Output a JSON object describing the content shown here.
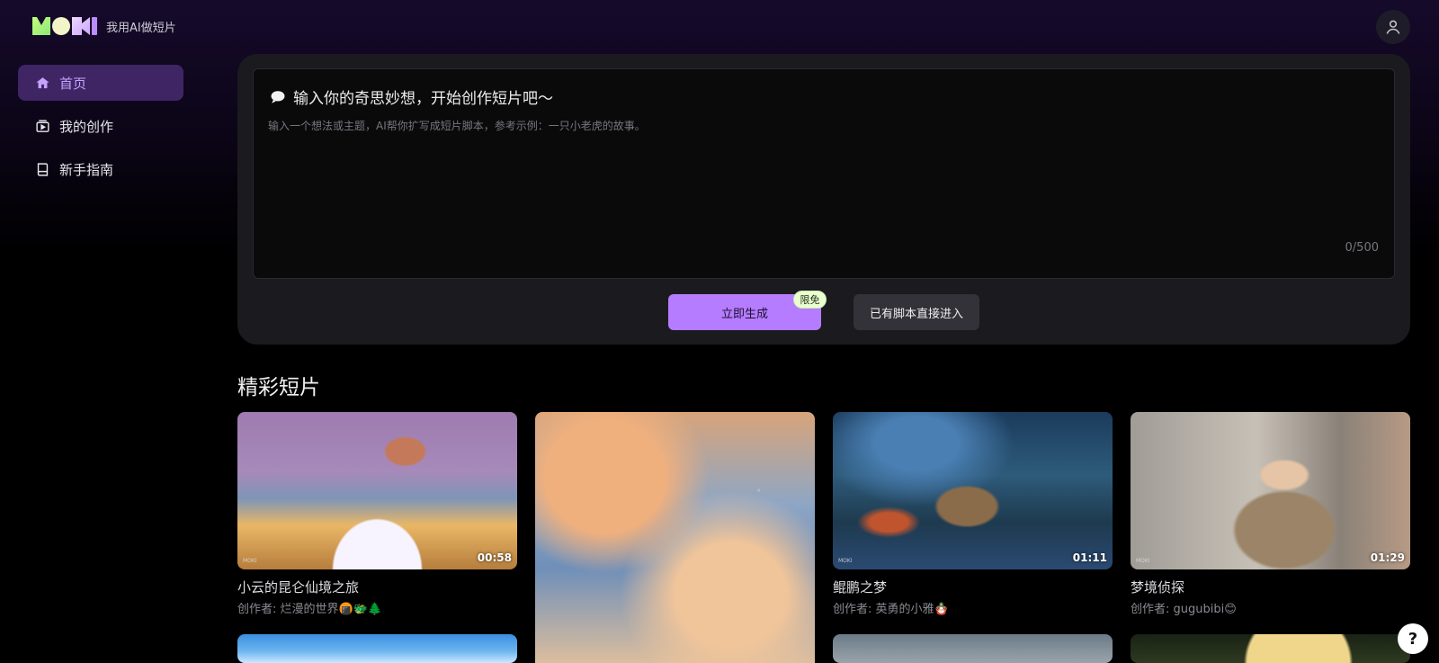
{
  "logo": {
    "tagline": "我用AI做短片",
    "mark_alt": "MOKI"
  },
  "sidebar": {
    "items": [
      {
        "label": "首页",
        "icon": "home-icon",
        "active": true
      },
      {
        "label": "我的创作",
        "icon": "video-library-icon",
        "active": false
      },
      {
        "label": "新手指南",
        "icon": "book-icon",
        "active": false
      }
    ]
  },
  "prompt": {
    "title": "输入你的奇思妙想，开始创作短片吧～",
    "placeholder": "输入一个想法或主题，AI帮你扩写成短片脚本，参考示例：一只小老虎的故事。",
    "counter": "0/500",
    "generate_label": "立即生成",
    "badge": "限免",
    "script_label": "已有脚本直接进入"
  },
  "section": {
    "title": "精彩短片"
  },
  "videos": [
    {
      "title": "小云的昆仑仙境之旅",
      "author": "创作者: 烂漫的世界🍘🐲🌲",
      "duration": "00:58",
      "watermark": "MOKI"
    },
    {
      "title": "",
      "author": "",
      "duration": "",
      "watermark": ""
    },
    {
      "title": "鲲鹏之梦",
      "author": "创作者: 英勇的小雅🪆",
      "duration": "01:11",
      "watermark": "MOKI"
    },
    {
      "title": "梦境侦探",
      "author": "创作者: gugubibi😊",
      "duration": "01:29",
      "watermark": "MOKI"
    }
  ],
  "help": {
    "label": "?"
  },
  "colors": {
    "accent": "#b67cff",
    "active_bg": "#3f2564",
    "card_bg": "#1b1a1f"
  }
}
